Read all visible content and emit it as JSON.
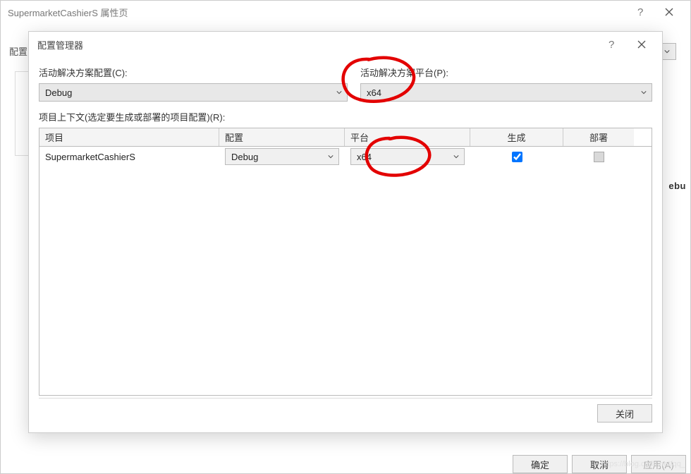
{
  "outer": {
    "title": "SupermarketCashierS 属性页",
    "config_label": "配置",
    "behind_partial": "ebu",
    "buttons": {
      "ok": "确定",
      "cancel": "取消",
      "apply": "应用(A)"
    },
    "menu_ellipsis": "..."
  },
  "inner": {
    "title": "配置管理器",
    "active_config_label": "活动解决方案配置(C):",
    "active_config_value": "Debug",
    "active_platform_label": "活动解决方案平台(P):",
    "active_platform_value": "x64",
    "context_label": "项目上下文(选定要生成或部署的项目配置)(R):",
    "columns": {
      "project": "项目",
      "config": "配置",
      "platform": "平台",
      "build": "生成",
      "deploy": "部署"
    },
    "rows": [
      {
        "project": "SupermarketCashierS",
        "config": "Debug",
        "platform": "x64",
        "build": true,
        "deploy_disabled": true
      }
    ],
    "close": "关闭"
  },
  "watermark": "https://blog.csdn.net/qq_"
}
